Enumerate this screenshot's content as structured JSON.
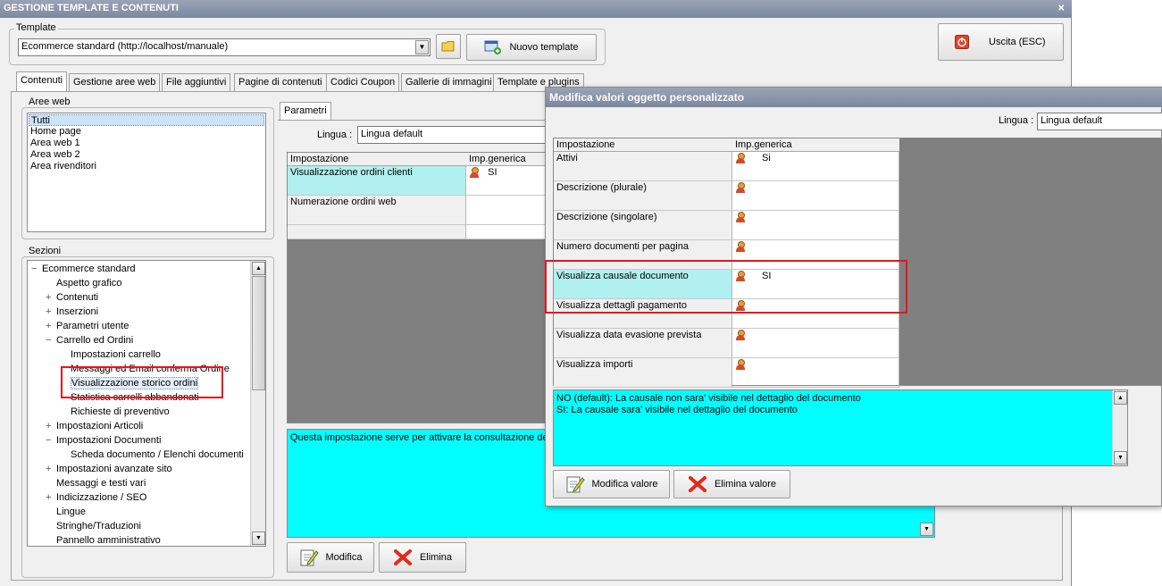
{
  "window": {
    "title": "GESTIONE TEMPLATE E CONTENUTI",
    "close_glyph": "×"
  },
  "template": {
    "label": "Template",
    "selected": "Ecommerce standard (http://localhost/manuale)",
    "new_button": "Nuovo template"
  },
  "exit_button": "Uscita (ESC)",
  "tabs": [
    "Contenuti",
    "Gestione aree web",
    "File aggiuntivi",
    "Pagine di contenuti",
    "Codici Coupon",
    "Gallerie di immagini",
    "Template e plugins"
  ],
  "aree_web": {
    "label": "Aree web",
    "items": [
      "Tutti",
      "Home page",
      "Area web 1",
      "Area web 2",
      "Area rivenditori"
    ]
  },
  "sezioni": {
    "label": "Sezioni",
    "items": [
      {
        "text": "Ecommerce standard",
        "exp": "−"
      },
      {
        "text": "Aspetto grafico",
        "exp": ""
      },
      {
        "text": "Contenuti",
        "exp": "+"
      },
      {
        "text": "Inserzioni",
        "exp": "+"
      },
      {
        "text": "Parametri utente",
        "exp": "+"
      },
      {
        "text": "Carrello ed Ordini",
        "exp": "−"
      },
      {
        "text": "Impostazioni carrello",
        "exp": ""
      },
      {
        "text": "Messaggi ed Email conferma Ordine",
        "exp": ""
      },
      {
        "text": "Visualizzazione storico ordini",
        "exp": ""
      },
      {
        "text": "Statistica carrelli abbandonati",
        "exp": ""
      },
      {
        "text": "Richieste di preventivo",
        "exp": ""
      },
      {
        "text": "Impostazioni Articoli",
        "exp": "+"
      },
      {
        "text": "Impostazioni Documenti",
        "exp": "−"
      },
      {
        "text": "Scheda documento / Elenchi documenti",
        "exp": ""
      },
      {
        "text": "Impostazioni avanzate sito",
        "exp": "+"
      },
      {
        "text": "Messaggi e testi vari",
        "exp": ""
      },
      {
        "text": "Indicizzazione / SEO",
        "exp": "+"
      },
      {
        "text": "Lingue",
        "exp": ""
      },
      {
        "text": "Stringhe/Traduzioni",
        "exp": ""
      },
      {
        "text": "Pannello amministrativo",
        "exp": ""
      }
    ]
  },
  "parametri": {
    "tab": "Parametri",
    "lingua_label": "Lingua :",
    "lingua_value": "Lingua default",
    "col_impostazione": "Impostazione",
    "col_imp_generica": "Imp.generica",
    "rows": [
      {
        "name": "Visualizzazione ordini clienti",
        "value": "SI"
      },
      {
        "name": "Numerazione ordini web",
        "value": ""
      }
    ],
    "description": "Questa impostazione serve per attivare la consultazione deg",
    "modifica": "Modifica",
    "elimina": "Elimina"
  },
  "dialog": {
    "title": "Modifica valori oggetto personalizzato",
    "lingua_label": "Lingua :",
    "lingua_value": "Lingua default",
    "col_impostazione": "Impostazione",
    "col_imp_generica": "Imp.generica",
    "rows": [
      {
        "name": "Attivi",
        "value": "Si"
      },
      {
        "name": "Descrizione (plurale)",
        "value": ""
      },
      {
        "name": "Descrizione (singolare)",
        "value": ""
      },
      {
        "name": "Numero documenti per pagina",
        "value": ""
      },
      {
        "name": "Visualizza causale documento",
        "value": "SI"
      },
      {
        "name": "Visualizza dettagli pagamento",
        "value": ""
      },
      {
        "name": "Visualizza data evasione prevista",
        "value": ""
      },
      {
        "name": "Visualizza importi",
        "value": ""
      }
    ],
    "description_line1": "NO (default): La causale non sara' visibile nel dettaglio del documento",
    "description_line2": "SI: La causale sara' visibile nel dettaglio del documento",
    "modifica_valore": "Modifica valore",
    "elimina_valore": "Elimina valore"
  },
  "colors": {
    "highlight_cyan": "#00ffff",
    "selection_row": "#b0f0f0",
    "red_outline": "#e8141a",
    "titlebar": "#8a95aa"
  }
}
